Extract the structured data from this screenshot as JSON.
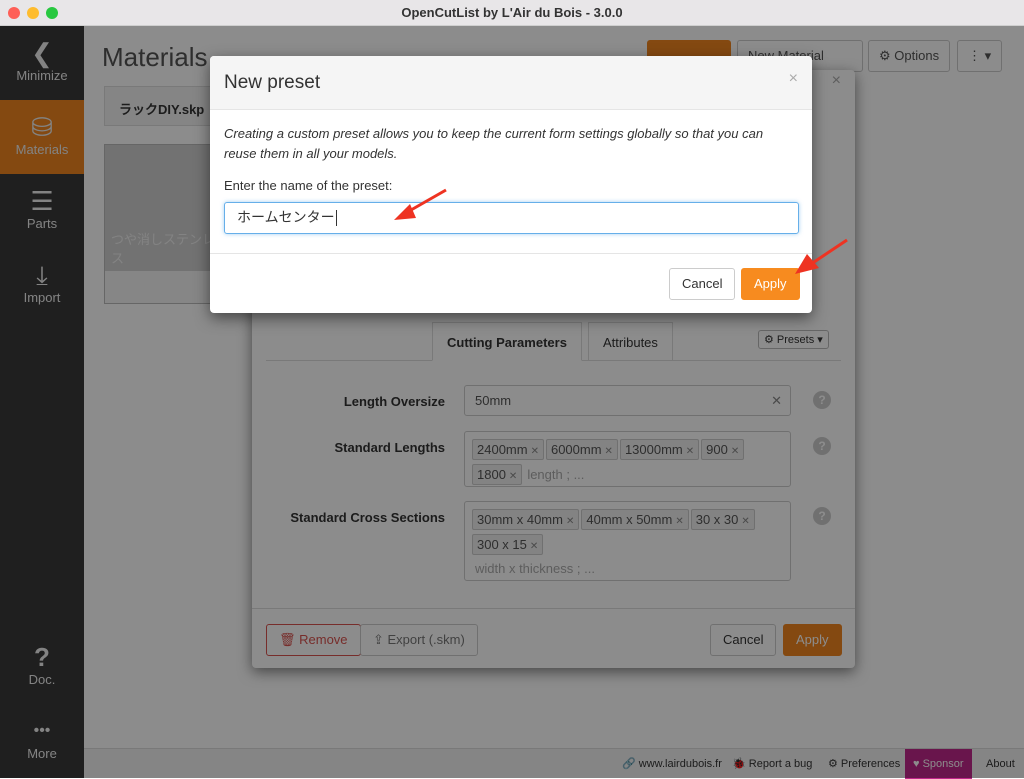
{
  "window": {
    "title": "OpenCutList by L'Air du Bois - 3.0.0"
  },
  "sidebar": {
    "items": [
      {
        "label": "Minimize",
        "icon": "chevron-left-icon",
        "glyph": "❮"
      },
      {
        "label": "Materials",
        "icon": "paint-bucket-icon",
        "glyph": "⛁",
        "active": true
      },
      {
        "label": "Parts",
        "icon": "list-icon",
        "glyph": "☰"
      },
      {
        "label": "Import",
        "icon": "import-icon",
        "glyph": "⤓"
      },
      {
        "label": "Doc.",
        "icon": "help-icon",
        "glyph": "?"
      },
      {
        "label": "More",
        "icon": "more-icon",
        "glyph": "•••"
      }
    ]
  },
  "header": {
    "title": "Materials",
    "options_label": "Options",
    "new_material_label": "New Material",
    "more_glyph": "⋮ ▾"
  },
  "file_tab": "ラックDIY.skp",
  "material_card": {
    "name": "つや消しステンレス"
  },
  "material_dialog": {
    "tabs": [
      "Cutting Parameters",
      "Attributes"
    ],
    "presets_label": "Presets",
    "fields": {
      "length_oversize": {
        "label": "Length Oversize",
        "value": "50mm"
      },
      "standard_lengths": {
        "label": "Standard Lengths",
        "tags": [
          "2400mm",
          "6000mm",
          "13000mm",
          "900",
          "1800"
        ],
        "placeholder": "length ; ..."
      },
      "standard_cross_sections": {
        "label": "Standard Cross Sections",
        "tags": [
          "30mm x 40mm",
          "40mm x 50mm",
          "30 x 30",
          "300 x 15"
        ],
        "placeholder": "width x thickness ; ..."
      }
    },
    "remove_label": "Remove",
    "export_label": "Export (.skm)",
    "cancel_label": "Cancel",
    "apply_label": "Apply"
  },
  "preset_modal": {
    "title": "New preset",
    "description": "Creating a custom preset allows you to keep the current form settings globally so that you can reuse them in all your models.",
    "input_label": "Enter the name of the preset:",
    "input_value": "ホームセンター",
    "cancel_label": "Cancel",
    "apply_label": "Apply"
  },
  "footer": {
    "website": "www.lairdubois.fr",
    "report_bug": "Report a bug",
    "preferences": "Preferences",
    "sponsor": "Sponsor",
    "about": "About"
  },
  "colors": {
    "accent": "#f0861f",
    "sponsor": "#9b1e6e",
    "sidebar": "#3a3a3a",
    "remove": "#d9534f",
    "annotation_arrow": "#ee3322"
  }
}
